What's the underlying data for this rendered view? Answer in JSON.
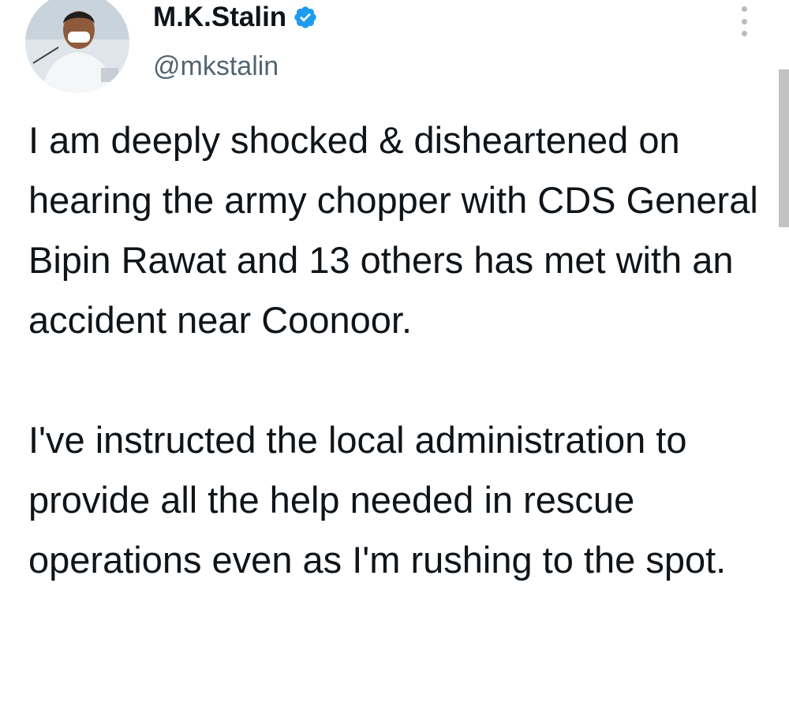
{
  "user": {
    "display_name": "M.K.Stalin",
    "handle": "@mkstalin",
    "verified": true,
    "verified_color": "#1d9bf0"
  },
  "tweet": {
    "paragraphs": [
      "I am deeply shocked & disheartened on hearing the army chopper with CDS General Bipin Rawat and 13 others has met with an accident near Coonoor.",
      "I've instructed the local administration to provide all the help needed in rescue operations even as I'm rushing to the spot."
    ]
  },
  "icons": {
    "more": "more-vertical-icon",
    "verified": "verified-badge-icon"
  }
}
